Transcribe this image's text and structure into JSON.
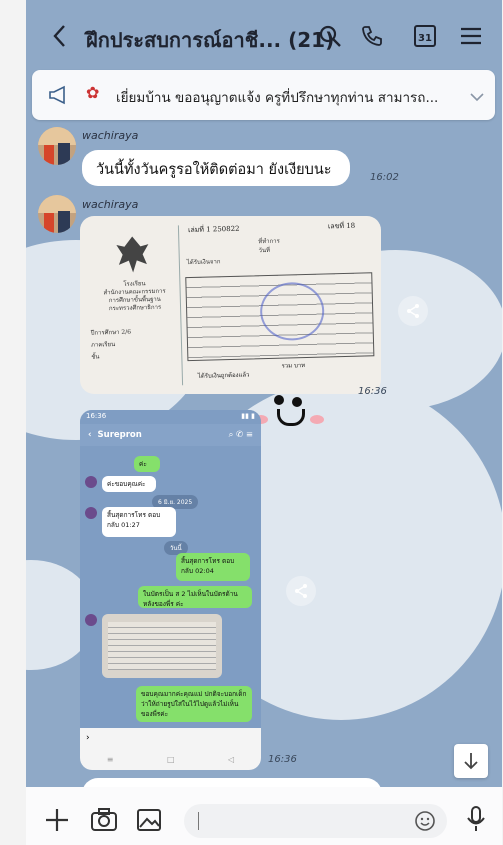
{
  "header": {
    "title": "ฝึกประสบการณ์อาชี... (21)",
    "icons": [
      "back-icon",
      "search-icon",
      "phone-icon",
      "calendar-icon",
      "menu-icon"
    ],
    "calendar_day": "31"
  },
  "announcement": {
    "text": "เยี่ยมบ้าน ขออนุญาตแจ้ง ครูที่ปรึกษาทุกท่าน สามารถ..."
  },
  "messages": [
    {
      "sender": "wachiraya",
      "text": "วันนี้ทั้งวันครูรอให้ติดต่อมา ยังเงียบนะ",
      "time": "16:02"
    },
    {
      "sender": "wachiraya",
      "type": "photo",
      "time": "16:36"
    },
    {
      "type": "screenshot",
      "time": "16:36"
    }
  ],
  "document": {
    "book_no": "เล่มที่ 1 250822",
    "receipt_no": "เลขที่ 18",
    "rows": [
      "ที่ทำการ",
      "วันที่",
      "ได้รับเงินจาก"
    ],
    "left_lines": [
      "โรงเรียน",
      "สำนักงานคณะกรรมการ",
      "การศึกษาขั้นพื้นฐาน",
      "กระทรวงศึกษาธิการ"
    ],
    "left_fields": [
      "ปีการศึกษา 2/6",
      "ภาคเรียน",
      "ชั้น"
    ],
    "total_label": "รวม บาท",
    "received_label": "ได้รับเงินถูกต้องแล้ว"
  },
  "screenshot": {
    "status_time": "16:36",
    "chat_name": "Surepron",
    "pills": [
      "6 มิ.ย. 2025",
      "วันนี้"
    ],
    "msgs": [
      {
        "side": "right",
        "text": "ค่ะ"
      },
      {
        "side": "left",
        "text": "ค่ะขอบคุณค่ะ"
      },
      {
        "side": "left",
        "text": "สิ้นสุดการโทร ตอบกลับ 01:27"
      },
      {
        "side": "right",
        "text": "สิ้นสุดการโทร ตอบกลับ 02:04"
      },
      {
        "side": "right",
        "text": "ในบัตรเป็น ส 2 ไม่เห็นในบัตรด้านหลังของพี่ร ค่ะ"
      },
      {
        "side": "right",
        "text": "ขอบคุณมากค่ะคุณแม่ ปกติจะบอกเด็กว่าให้ถ่ายรูปใส่ในไว้ไปดูแล้วไม่เห็นของพี่รค่ะ"
      }
    ]
  },
  "bottom": {
    "icons": [
      "plus-icon",
      "camera-icon",
      "image-icon",
      "emoji-icon",
      "mic-icon"
    ],
    "input_placeholder": ""
  },
  "colors": {
    "chat_bg": "#8fa9c7",
    "bubble": "#ffffff",
    "green": "#85e06b"
  }
}
